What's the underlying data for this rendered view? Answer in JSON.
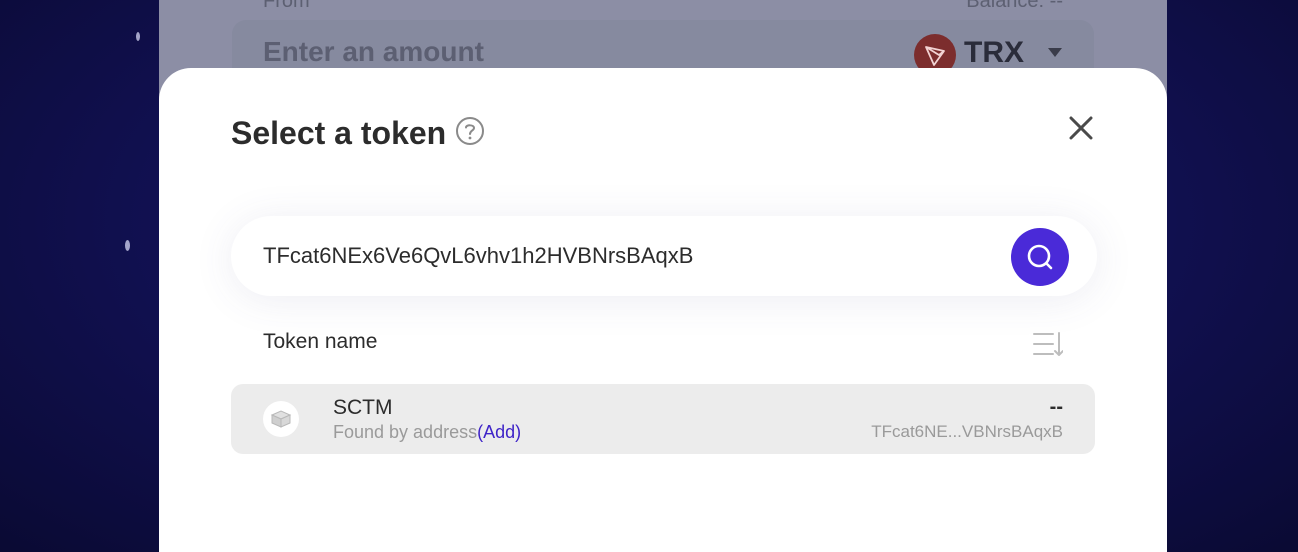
{
  "background": {
    "from_label": "From",
    "balance_label": "Balance: --",
    "amount_placeholder": "Enter an amount",
    "token_symbol": "TRX",
    "logo_icon": "tron-logo-icon"
  },
  "modal": {
    "title": "Select a token",
    "help_icon": "question-circle-icon",
    "close_icon": "close-icon",
    "search": {
      "value": "TFcat6NEx6Ve6QvL6vhv1h2HVBNrsBAqxB",
      "button_icon": "search-icon",
      "accent_color": "#4a2ad8"
    },
    "list_header": {
      "label": "Token name",
      "sort_icon": "sort-icon"
    },
    "tokens": [
      {
        "symbol": "SCTM",
        "subtitle": "Found by address",
        "add_label": "(Add)",
        "balance": "--",
        "address": "TFcat6NE...VBNrsBAqxB",
        "icon": "token-placeholder-icon"
      }
    ]
  }
}
